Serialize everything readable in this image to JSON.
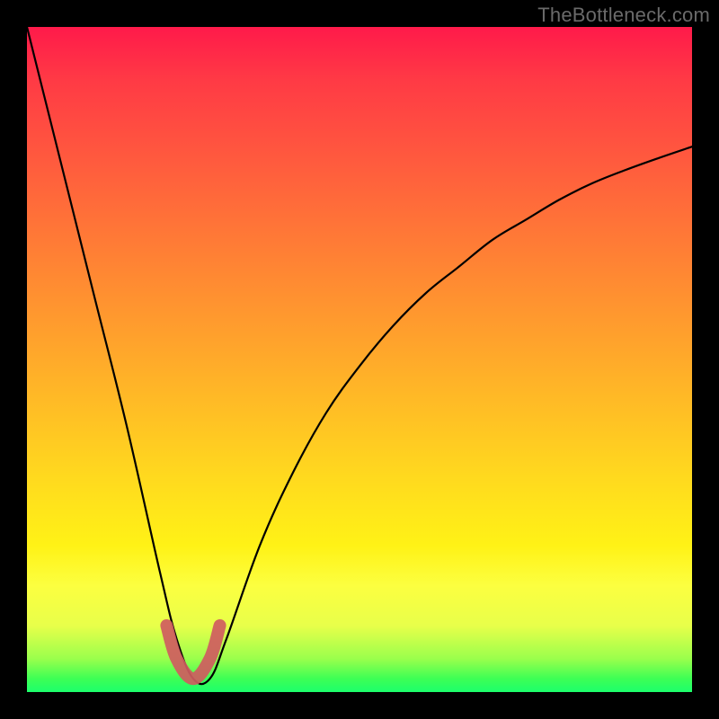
{
  "watermark": "TheBottleneck.com",
  "chart_data": {
    "type": "line",
    "title": "",
    "xlabel": "",
    "ylabel": "",
    "xlim": [
      0,
      100
    ],
    "ylim": [
      0,
      100
    ],
    "grid": false,
    "legend": false,
    "background_gradient": [
      "#ff1a4a",
      "#ff7a36",
      "#ffda1e",
      "#fcff40",
      "#1cff6c"
    ],
    "series": [
      {
        "name": "bottleneck-curve",
        "color": "#000000",
        "x": [
          0,
          5,
          10,
          15,
          20,
          22.5,
          25,
          27.5,
          30,
          35,
          40,
          45,
          50,
          55,
          60,
          65,
          70,
          75,
          80,
          85,
          90,
          95,
          100
        ],
        "y": [
          100,
          80,
          60,
          40,
          18,
          8,
          2,
          2,
          8,
          22,
          33,
          42,
          49,
          55,
          60,
          64,
          68,
          71,
          74,
          76.5,
          78.5,
          80.3,
          82
        ]
      },
      {
        "name": "optimal-region-highlight",
        "color": "#cf5c60",
        "x": [
          21,
          22.5,
          25,
          27.5,
          29
        ],
        "y": [
          10,
          5,
          2,
          5,
          10
        ]
      }
    ],
    "notes": "V-shaped bottleneck curve; minimum (optimal) near x≈25 where curve touches 0. Right branch rises with diminishing slope."
  }
}
